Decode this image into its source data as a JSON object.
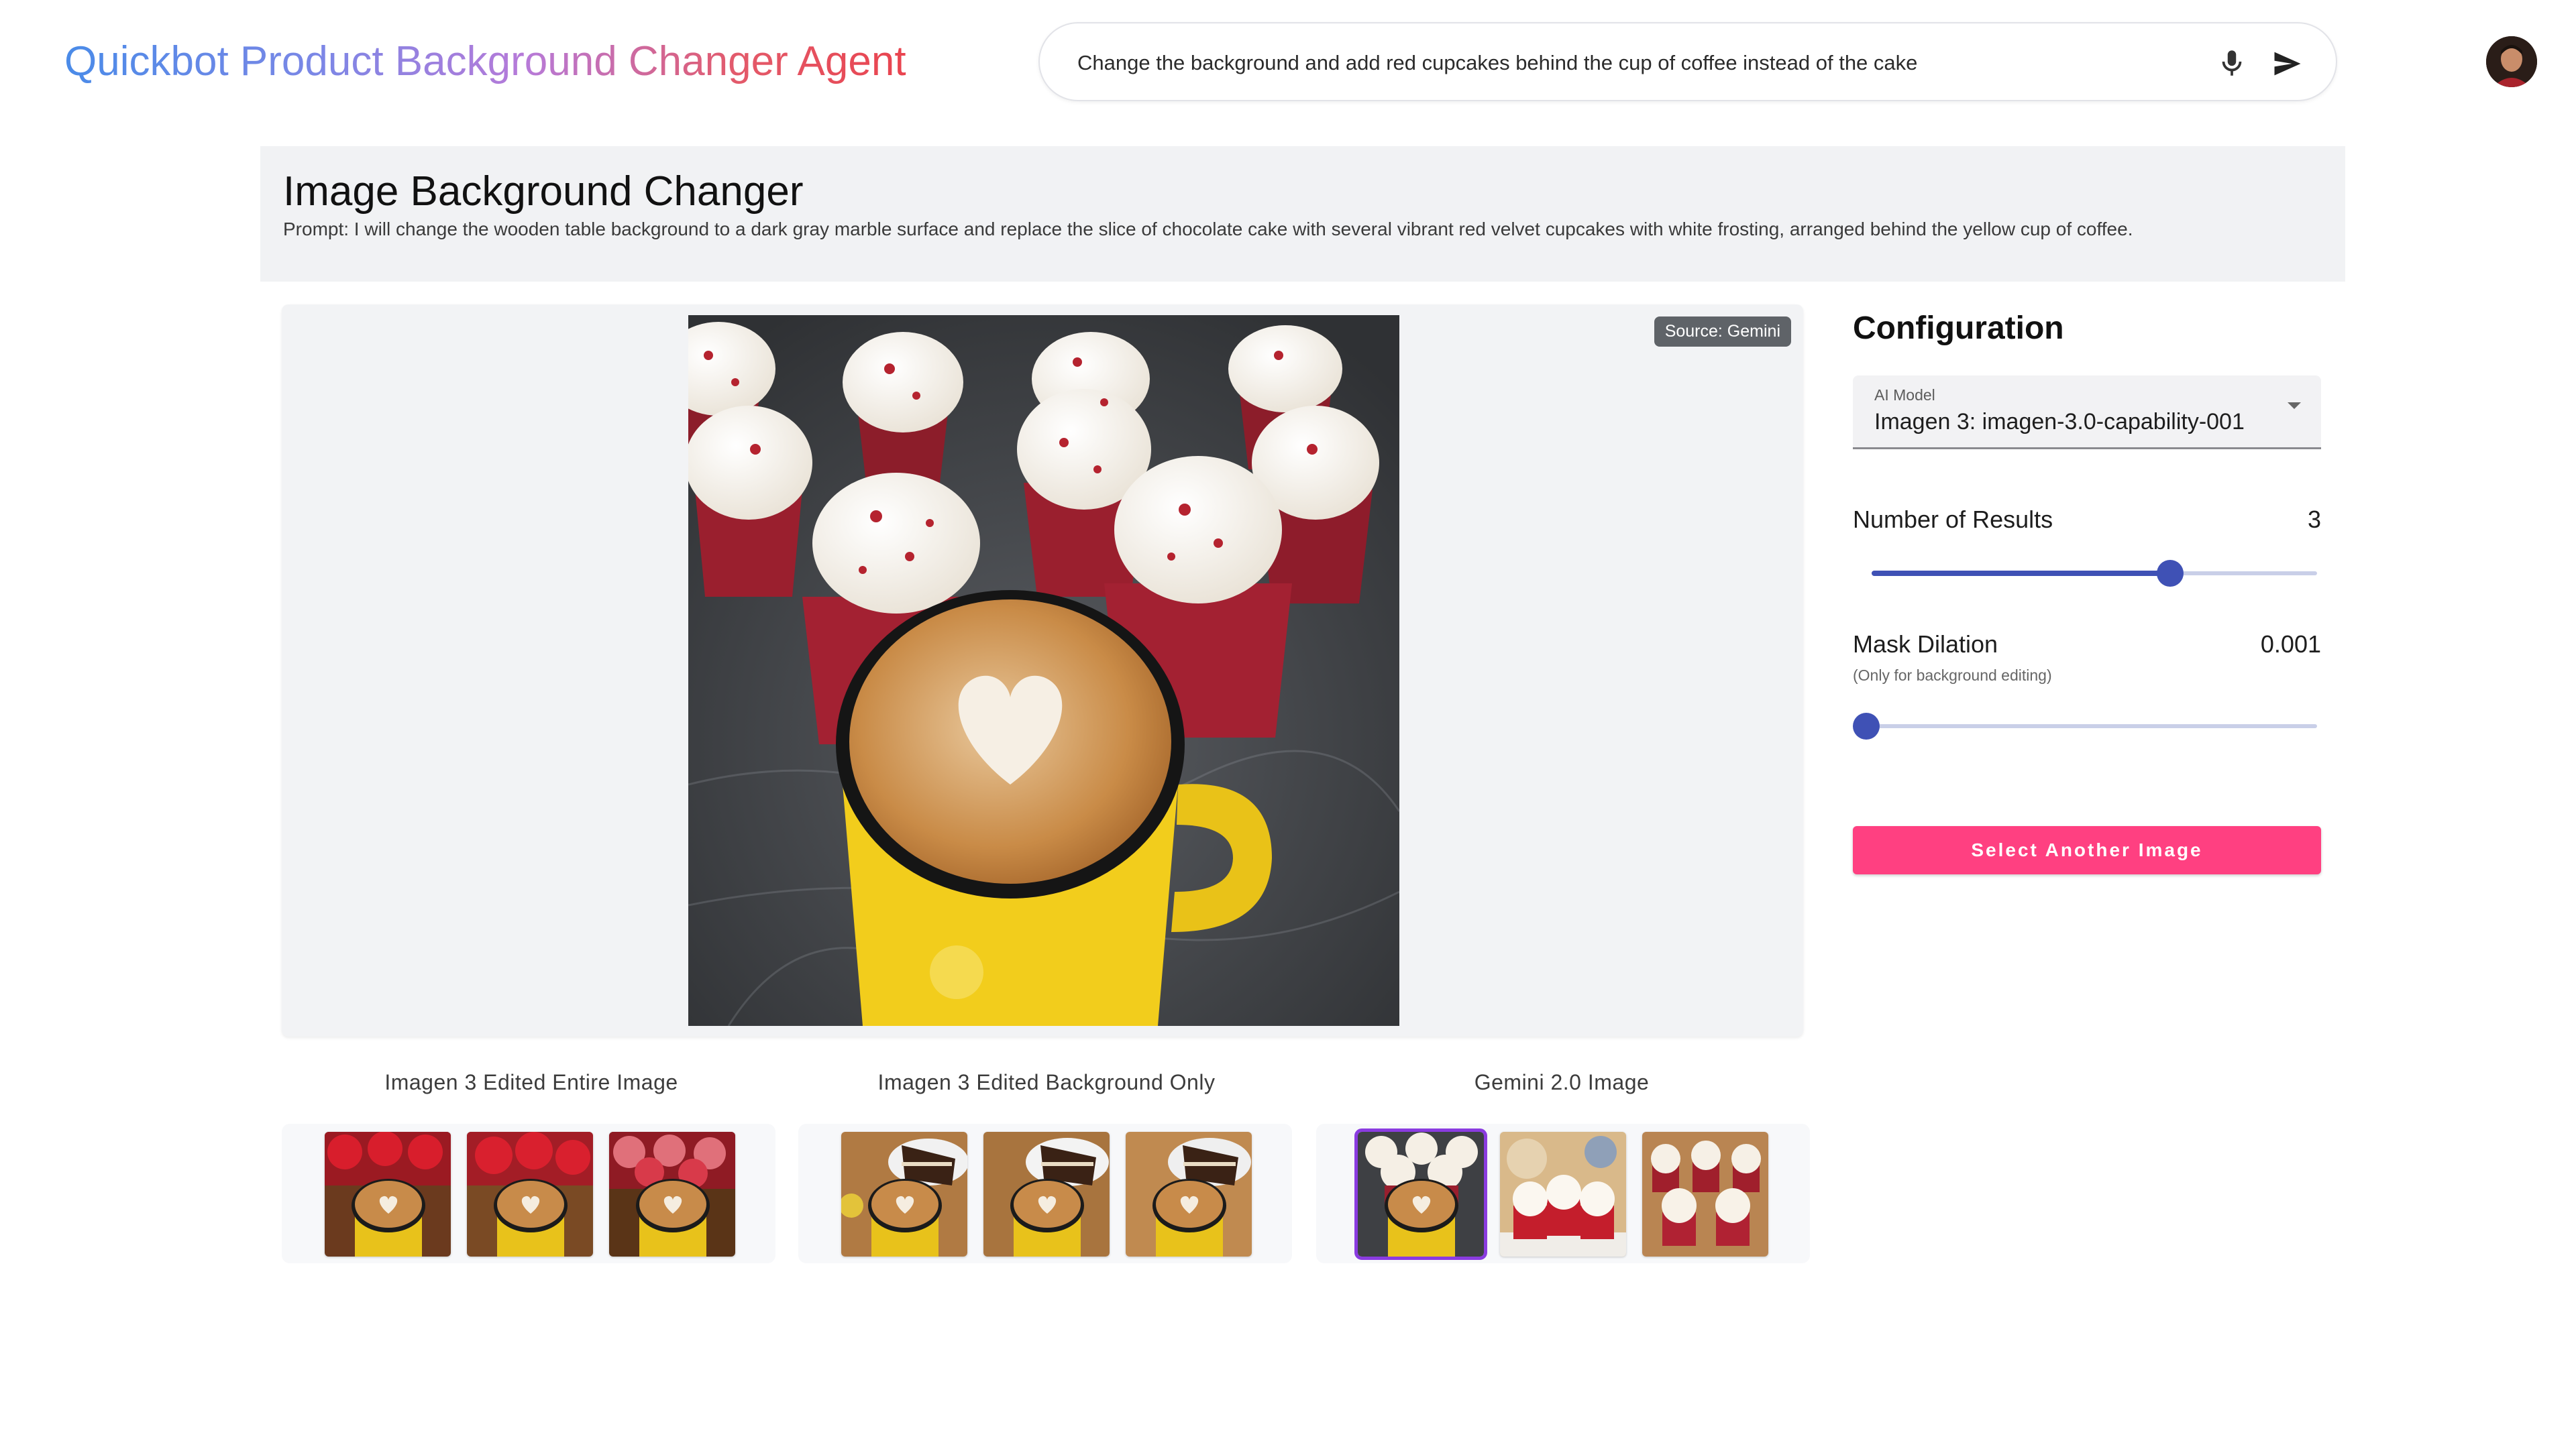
{
  "header": {
    "app_title": "Quickbot Product Background Changer Agent",
    "search_value": "Change the background and add red cupcakes behind the cup of coffee instead of the cake",
    "mic_icon": "microphone-icon",
    "send_icon": "send-icon"
  },
  "panel": {
    "title": "Image Background Changer",
    "prompt": "Prompt: I will change the wooden table background to a dark gray marble surface and replace the slice of chocolate cake with several vibrant red velvet cupcakes with white frosting, arranged behind the yellow cup of coffee."
  },
  "main_image": {
    "source_badge": "Source: Gemini"
  },
  "result_groups": [
    {
      "label": "Imagen 3 Edited Entire Image"
    },
    {
      "label": "Imagen 3 Edited Background Only"
    },
    {
      "label": "Gemini 2.0 Image"
    }
  ],
  "config": {
    "title": "Configuration",
    "model_label": "AI Model",
    "model_value": "Imagen 3: imagen-3.0-capability-001",
    "results_label": "Number of Results",
    "results_value": "3",
    "results_slider_fraction": 0.67,
    "dilation_label": "Mask Dilation",
    "dilation_value": "0.001",
    "dilation_hint": "(Only for background editing)",
    "dilation_slider_fraction": 0.0,
    "select_another_label": "Select Another Image"
  },
  "colors": {
    "accent": "#3f51b5",
    "button": "#ff4081",
    "selected_outline": "#8a3be0"
  }
}
